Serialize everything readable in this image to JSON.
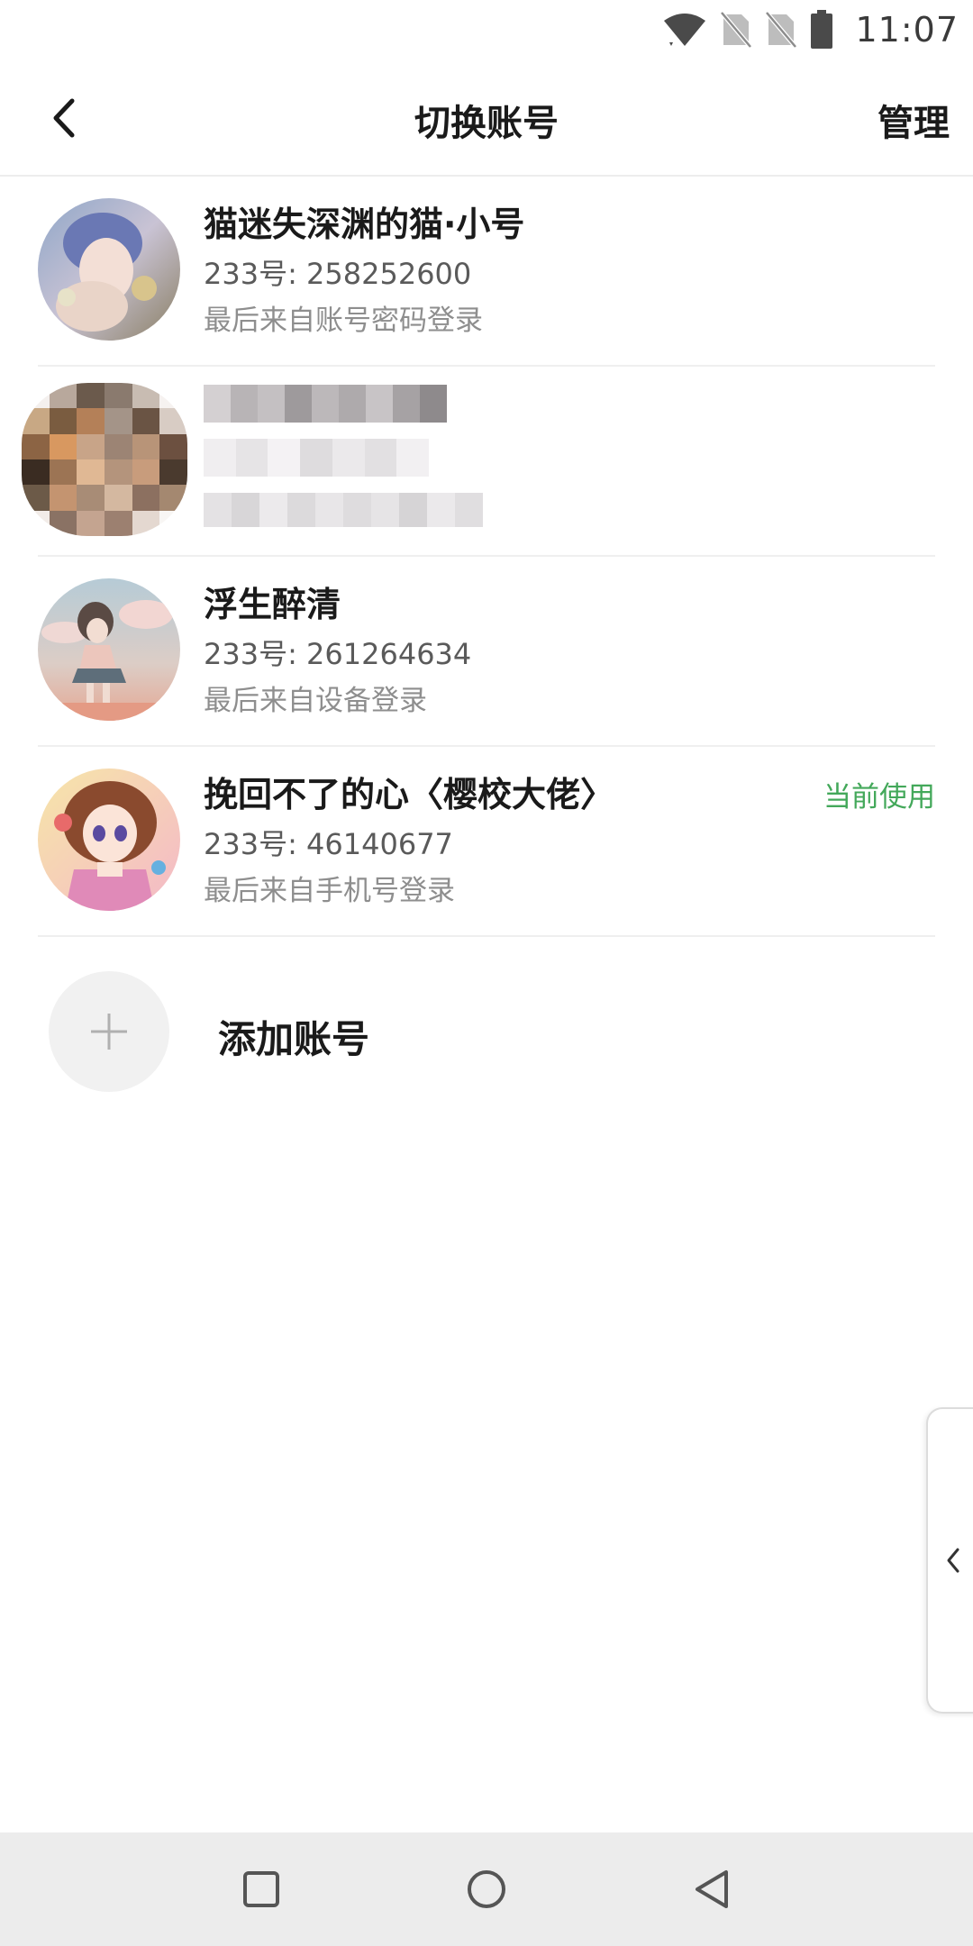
{
  "status_bar": {
    "time": "11:07",
    "icons": [
      "wifi-icon",
      "no-sim-icon",
      "no-sim-icon",
      "battery-icon"
    ]
  },
  "header": {
    "title": "切换账号",
    "manage_label": "管理",
    "back_icon": "chevron-left-icon"
  },
  "accounts": [
    {
      "nickname": "猫迷失深渊的猫·小号",
      "uid": "233号: 258252600",
      "login_source": "最后来自账号密码登录",
      "current": ""
    },
    {
      "nickname": "",
      "uid": "",
      "login_source": "",
      "current": "",
      "redacted": true
    },
    {
      "nickname": "浮生醉清",
      "uid": "233号: 261264634",
      "login_source": "最后来自设备登录",
      "current": ""
    },
    {
      "nickname": "挽回不了的心〈樱校大佬〉",
      "uid": "233号: 46140677",
      "login_source": "最后来自手机号登录",
      "current": "当前使用"
    }
  ],
  "add_account": {
    "label": "添加账号",
    "icon": "plus-icon"
  },
  "side_tab": {
    "icon": "chevron-left-icon"
  },
  "nav_bar": {
    "icons": [
      "recents-square-icon",
      "home-circle-icon",
      "back-triangle-icon"
    ]
  },
  "colors": {
    "accent_current": "#43a85a",
    "divider": "#efefef",
    "nav_bg": "#ececec"
  }
}
